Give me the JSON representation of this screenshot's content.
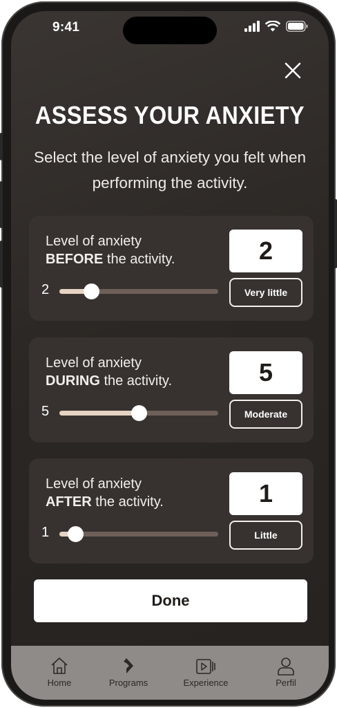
{
  "status": {
    "time": "9:41"
  },
  "header": {
    "title": "ASSESS YOUR ANXIETY",
    "subtitle": "Select the level of anxiety you felt when performing the activity."
  },
  "cards": [
    {
      "label_prefix": "Level of anxiety",
      "label_strong": "BEFORE",
      "label_suffix": " the activity.",
      "value": "2",
      "value_text": "Very little",
      "level": 2
    },
    {
      "label_prefix": "Level of anxiety",
      "label_strong": "DURING",
      "label_suffix": " the activity.",
      "value": "5",
      "value_text": "Moderate",
      "level": 5
    },
    {
      "label_prefix": "Level of anxiety",
      "label_strong": "AFTER",
      "label_suffix": " the activity.",
      "value": "1",
      "value_text": "Little",
      "level": 1
    }
  ],
  "slider": {
    "min": 0,
    "max": 10
  },
  "done_label": "Done",
  "tabs": [
    {
      "label": "Home",
      "icon": "home-icon"
    },
    {
      "label": "Programs",
      "icon": "programs-icon"
    },
    {
      "label": "Experience",
      "icon": "video-icon"
    },
    {
      "label": "Perfil",
      "icon": "user-icon"
    }
  ],
  "colors": {
    "background": "#2b2724",
    "card": "#37322f",
    "slider_fill": "#e6d3c2",
    "slider_track": "#6e6059",
    "tabbar": "#8e8b89"
  }
}
